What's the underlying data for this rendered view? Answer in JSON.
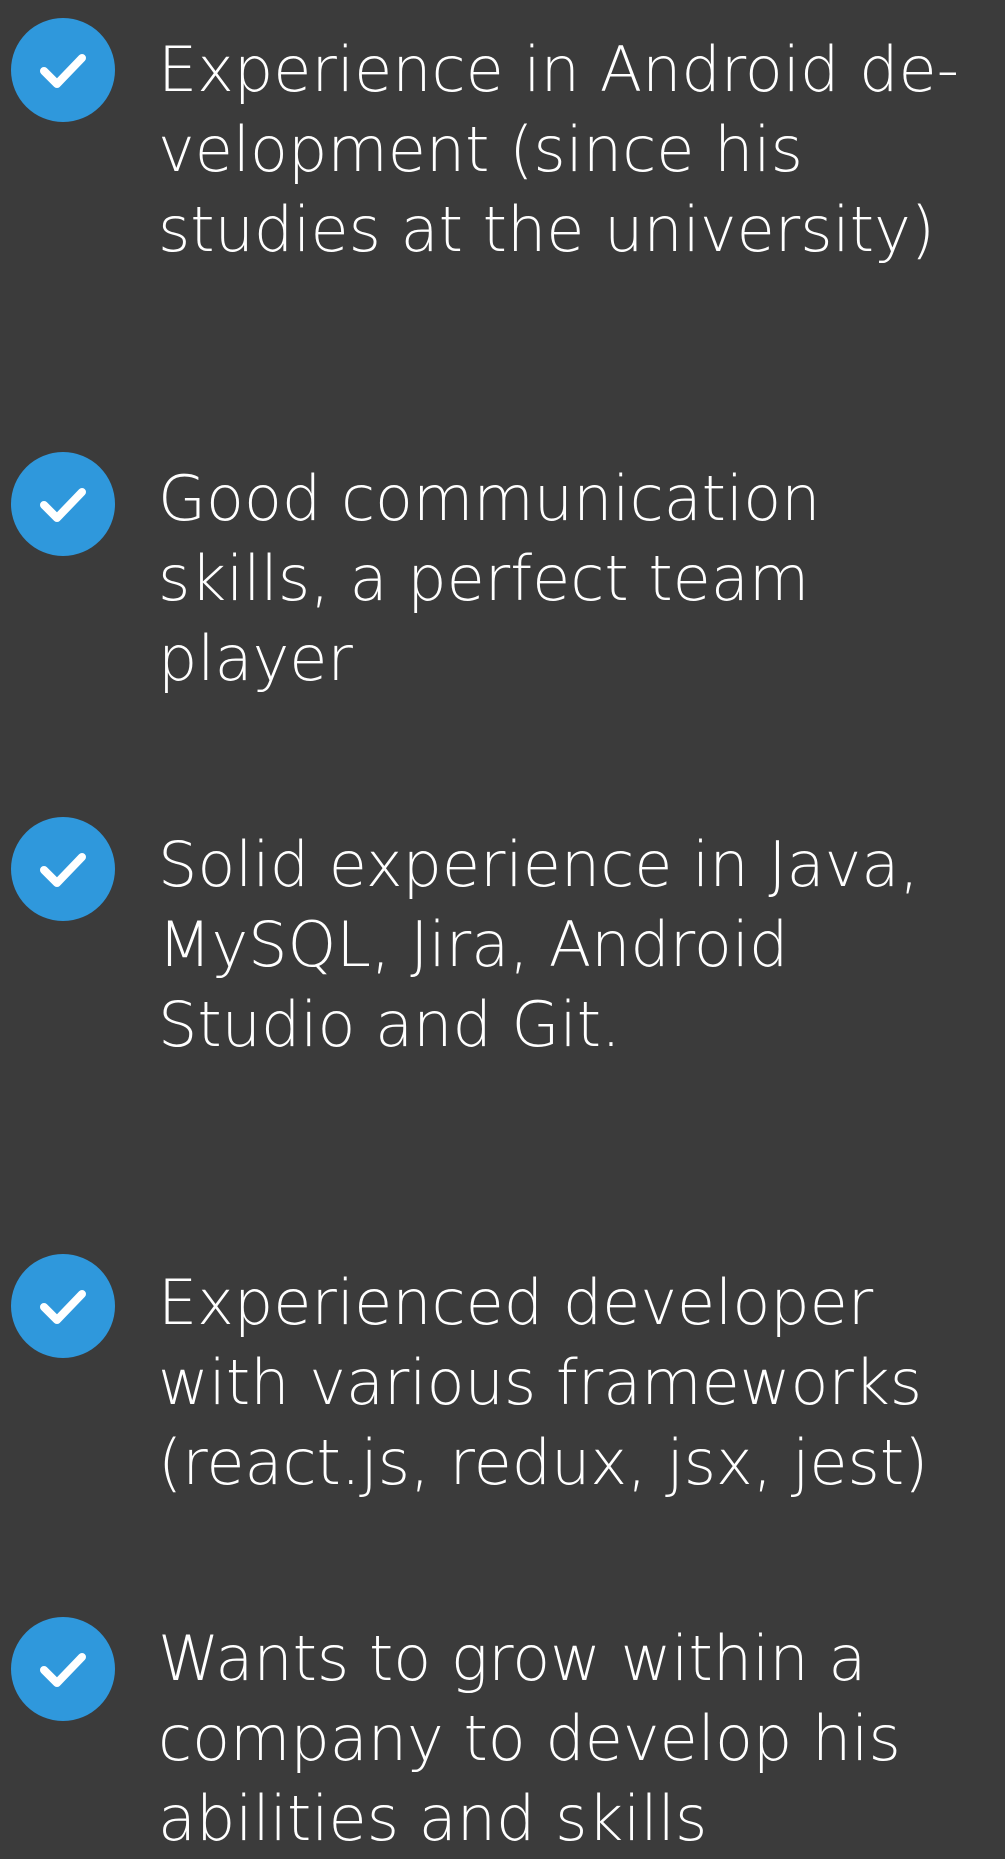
{
  "colors": {
    "background": "#3b3b3b",
    "check_circle": "#2f98dc",
    "text": "#ffffff"
  },
  "items": [
    {
      "icon": "check-circle-icon",
      "lines": [
        "Experience in Android de-",
        "velopment (since his",
        "studies at the university)"
      ]
    },
    {
      "icon": "check-circle-icon",
      "lines": [
        "Good communication",
        "skills, a perfect team",
        "player"
      ]
    },
    {
      "icon": "check-circle-icon",
      "lines": [
        "Solid experience in Java,",
        "MySQL, Jira,  Android",
        "Studio and Git."
      ]
    },
    {
      "icon": "check-circle-icon",
      "lines": [
        "Experienced developer",
        "with various frameworks",
        "(react.js, redux, jsx, jest)"
      ]
    },
    {
      "icon": "check-circle-icon",
      "lines": [
        "Wants to grow within a",
        "company to develop his",
        "abilities and skills"
      ]
    }
  ]
}
